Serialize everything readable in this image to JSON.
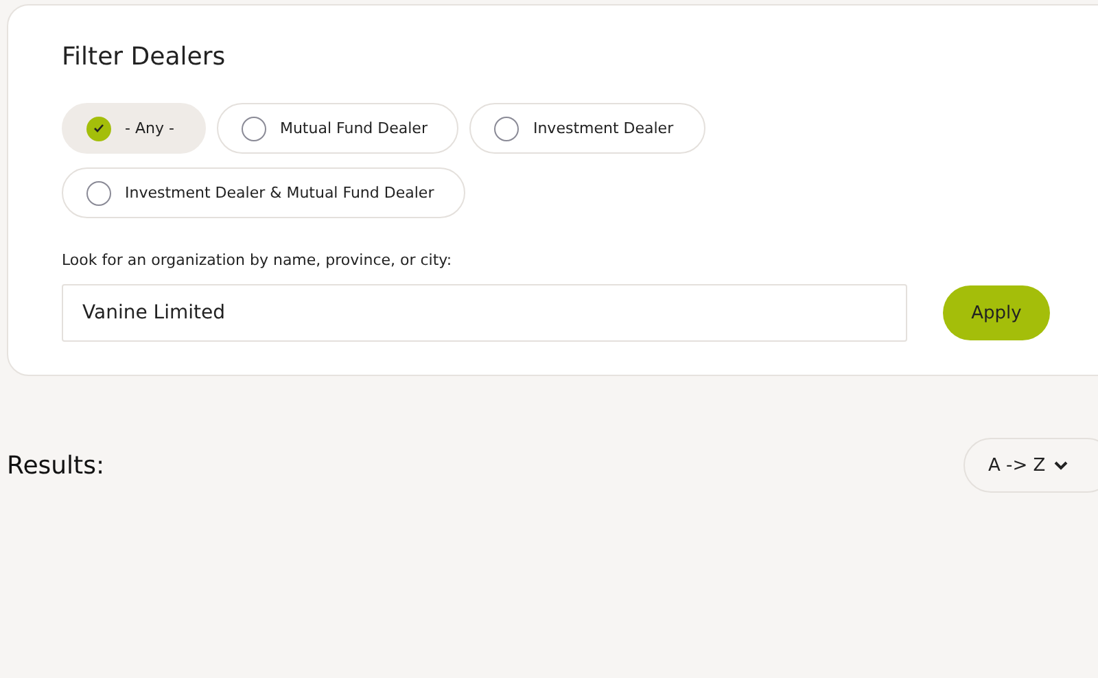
{
  "filter": {
    "title": "Filter Dealers",
    "options": [
      {
        "label": "- Any -",
        "selected": true
      },
      {
        "label": "Mutual Fund Dealer",
        "selected": false
      },
      {
        "label": "Investment Dealer",
        "selected": false
      },
      {
        "label": "Investment Dealer & Mutual Fund Dealer",
        "selected": false
      }
    ],
    "search": {
      "label": "Look for an organization by name, province, or city:",
      "value": "Vanine Limited"
    },
    "apply_button": "Apply"
  },
  "results": {
    "title": "Results:",
    "sort": "A -> Z"
  }
}
